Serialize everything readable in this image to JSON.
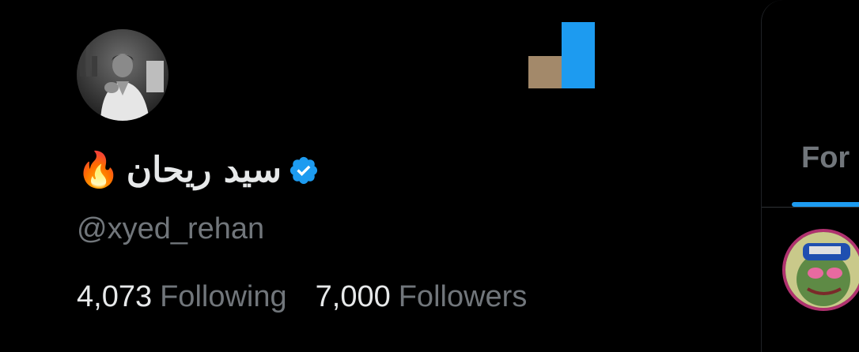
{
  "profile": {
    "display_name": "سيد ريحان",
    "name_emoji": "🔥",
    "handle": "@xyed_rehan",
    "following_count": "4,073",
    "following_label": "Following",
    "followers_count": "7,000",
    "followers_label": "Followers",
    "verified": true
  },
  "main": {
    "tabs": [
      {
        "label": "For"
      }
    ]
  },
  "colors": {
    "background": "#000000",
    "primary_text": "#e7e9ea",
    "secondary_text": "#71767b",
    "accent": "#1d9bf0",
    "logo_tan": "#a3896a",
    "post_avatar_ring": "#b0326f"
  },
  "icons": {
    "verified": "verified-badge-icon",
    "emoji": "fire-emoji-icon"
  }
}
